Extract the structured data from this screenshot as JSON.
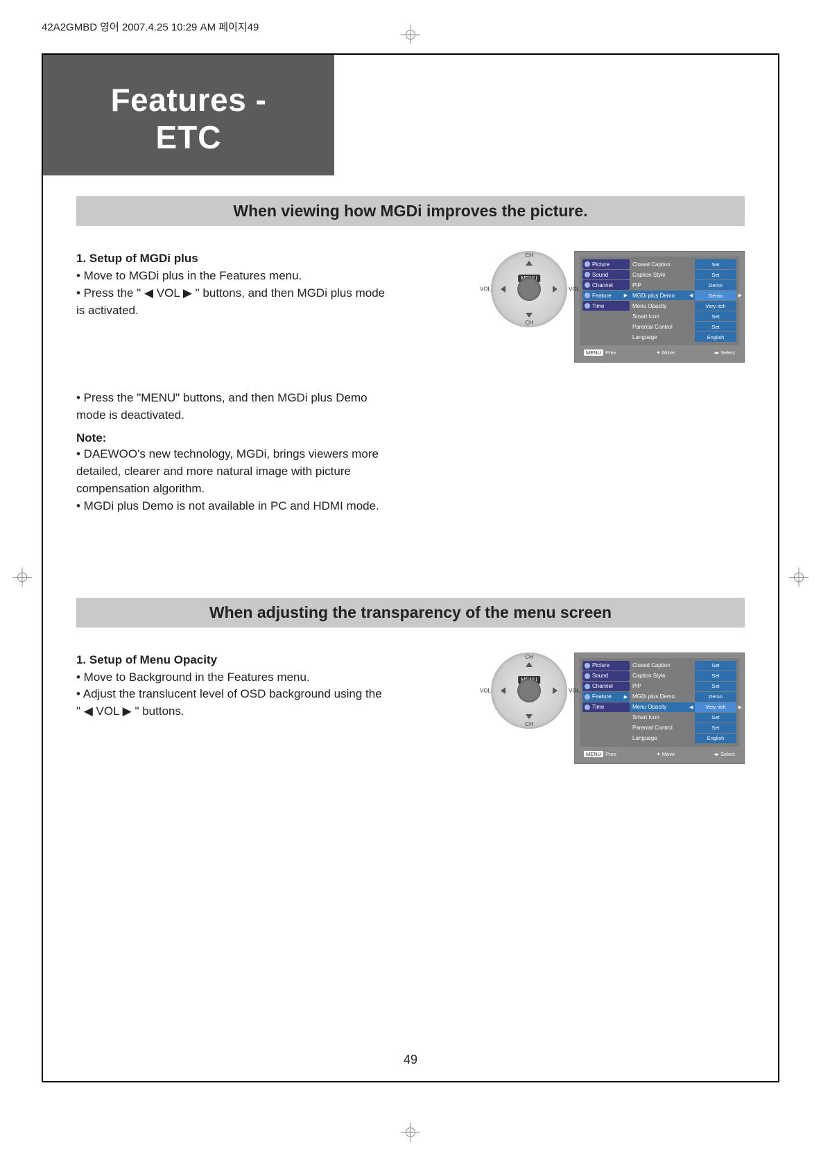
{
  "header": {
    "file_stamp": "42A2GMBD 영어 2007.4.25 10:29 AM 페이지49"
  },
  "title": {
    "line1": "Features -",
    "line2": "ETC"
  },
  "page_number": "49",
  "sectionA": {
    "bar": "When viewing how MGDi improves the picture.",
    "sub1": "1. Setup of MGDi plus",
    "b1": "• Move to MGDi plus in the Features menu.",
    "b2a": "• Press the \" ◀ VOL ▶ \" buttons, and then MGDi plus mode",
    "b2b": "  is activated.",
    "b3a": "• Press the \"MENU\" buttons, and then MGDi plus Demo",
    "b3b": "  mode is deactivated.",
    "note_head": "Note:",
    "n1a": "• DAEWOO's new technology, MGDi, brings viewers more",
    "n1b": "  detailed, clearer and more natural image with picture",
    "n1c": "  compensation algorithm.",
    "n2": "• MGDi plus Demo is not available in PC and HDMI mode."
  },
  "sectionB": {
    "bar": "When adjusting the transparency of the menu screen",
    "sub1": "1. Setup of Menu Opacity",
    "b1": "• Move to Background in the Features menu.",
    "b2a": "• Adjust the translucent level of OSD background using the",
    "b2b": "  \" ◀ VOL ▶ \" buttons."
  },
  "dpad": {
    "menu": "MENU",
    "ch": "CH",
    "vol_l": "VOL",
    "vol_r": "VOL"
  },
  "osdA": {
    "tabs": [
      "Picture",
      "Sound",
      "Channel",
      "Feature",
      "Time"
    ],
    "sel_tab_index": 3,
    "items": [
      {
        "label": "Closed Caption",
        "value": "Set"
      },
      {
        "label": "Caption Style",
        "value": "Set"
      },
      {
        "label": "PIP",
        "value": "Demo"
      },
      {
        "label": "MGDi plus Demo",
        "value": "Demo",
        "highlight": true
      },
      {
        "label": "Menu Opacity",
        "value": "Very rich"
      },
      {
        "label": "Smart Icon",
        "value": "Set"
      },
      {
        "label": "Parental Control",
        "value": "Set"
      },
      {
        "label": "Language",
        "value": "English"
      }
    ],
    "footer": {
      "prev_tag": "MENU",
      "prev": "Prev.",
      "move": "Move",
      "select": "Select"
    }
  },
  "osdB": {
    "tabs": [
      "Picture",
      "Sound",
      "Channel",
      "Feature",
      "Time"
    ],
    "sel_tab_index": 3,
    "items": [
      {
        "label": "Closed Caption",
        "value": "Set"
      },
      {
        "label": "Caption Style",
        "value": "Set"
      },
      {
        "label": "PIP",
        "value": "Set"
      },
      {
        "label": "MGDi plus Demo",
        "value": "Demo"
      },
      {
        "label": "Menu Opacity",
        "value": "Very rich",
        "highlight": true
      },
      {
        "label": "Smart Icon",
        "value": "Set"
      },
      {
        "label": "Parental Control",
        "value": "Set"
      },
      {
        "label": "Language",
        "value": "English"
      }
    ],
    "footer": {
      "prev_tag": "MENU",
      "prev": "Prev.",
      "move": "Move",
      "select": "Select"
    }
  }
}
